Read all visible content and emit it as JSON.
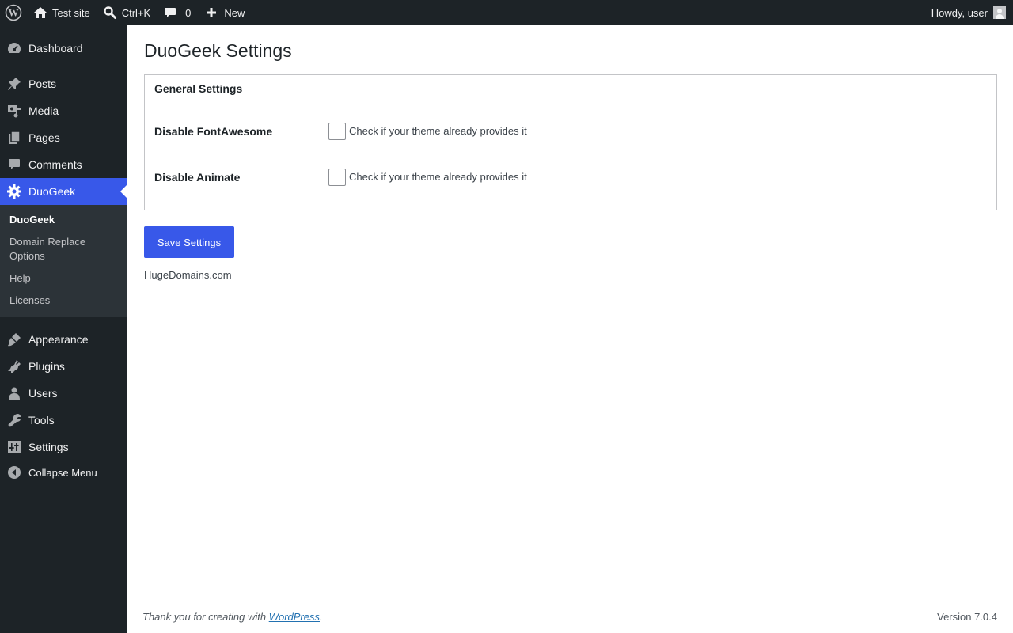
{
  "admin_bar": {
    "site_name": "Test site",
    "search_shortcut": "Ctrl+K",
    "comments_count": "0",
    "new_label": "New",
    "greeting": "Howdy, user"
  },
  "sidebar": {
    "items": [
      {
        "label": "Dashboard",
        "icon": "dashboard-icon"
      },
      {
        "label": "Posts",
        "icon": "pin-icon"
      },
      {
        "label": "Media",
        "icon": "media-icon"
      },
      {
        "label": "Pages",
        "icon": "pages-icon"
      },
      {
        "label": "Comments",
        "icon": "comment-icon"
      },
      {
        "label": "DuoGeek",
        "icon": "gear-icon"
      },
      {
        "label": "Appearance",
        "icon": "paintbrush-icon"
      },
      {
        "label": "Plugins",
        "icon": "plugin-icon"
      },
      {
        "label": "Users",
        "icon": "user-icon"
      },
      {
        "label": "Tools",
        "icon": "wrench-icon"
      },
      {
        "label": "Settings",
        "icon": "sliders-icon"
      }
    ],
    "submenu": [
      "DuoGeek",
      "Domain Replace Options",
      "Help",
      "Licenses"
    ],
    "collapse_label": "Collapse Menu"
  },
  "page": {
    "title": "DuoGeek Settings",
    "section_title": "General Settings",
    "settings": [
      {
        "label": "Disable FontAwesome",
        "description": "Check if your theme already provides it",
        "checked": false
      },
      {
        "label": "Disable Animate",
        "description": "Check if your theme already provides it",
        "checked": false
      }
    ],
    "save_label": "Save Settings",
    "credit": "HugeDomains.com"
  },
  "footer": {
    "thanks_prefix": "Thank you for creating with ",
    "thanks_link": "WordPress",
    "thanks_suffix": ".",
    "version": "Version 7.0.4"
  },
  "colors": {
    "admin_bar_bg": "#1d2327",
    "accent": "#3858e9",
    "submenu_bg": "#2c3338"
  }
}
